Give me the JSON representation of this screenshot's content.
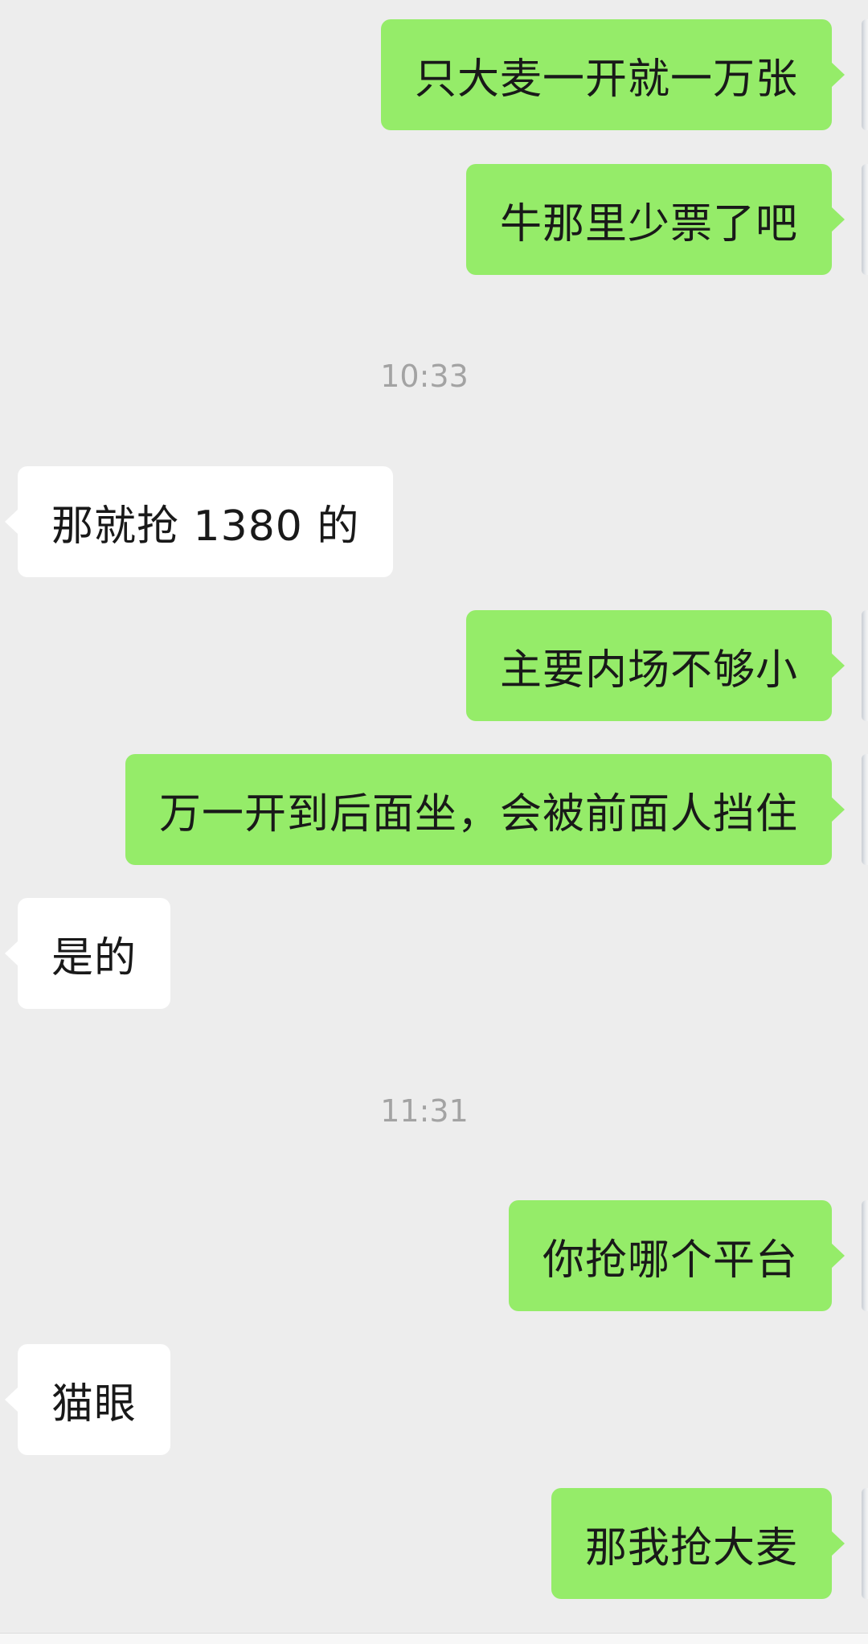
{
  "messages": [
    {
      "side": "out",
      "text": "只大麦一开就一万张"
    },
    {
      "side": "out",
      "text": "牛那里少票了吧"
    },
    {
      "side": "time",
      "text": "10:33"
    },
    {
      "side": "in",
      "text": "那就抢 1380 的"
    },
    {
      "side": "out",
      "text": "主要内场不够小"
    },
    {
      "side": "out",
      "text": "万一开到后面坐，会被前面人挡住"
    },
    {
      "side": "in",
      "text": "是的"
    },
    {
      "side": "time",
      "text": "11:31"
    },
    {
      "side": "out",
      "text": "你抢哪个平台"
    },
    {
      "side": "in",
      "text": "猫眼"
    },
    {
      "side": "out",
      "text": "那我抢大麦"
    }
  ],
  "colors": {
    "background": "#ededed",
    "outgoing_bubble": "#95ec69",
    "incoming_bubble": "#ffffff",
    "text": "#191919",
    "timestamp": "#a3a3a3"
  }
}
